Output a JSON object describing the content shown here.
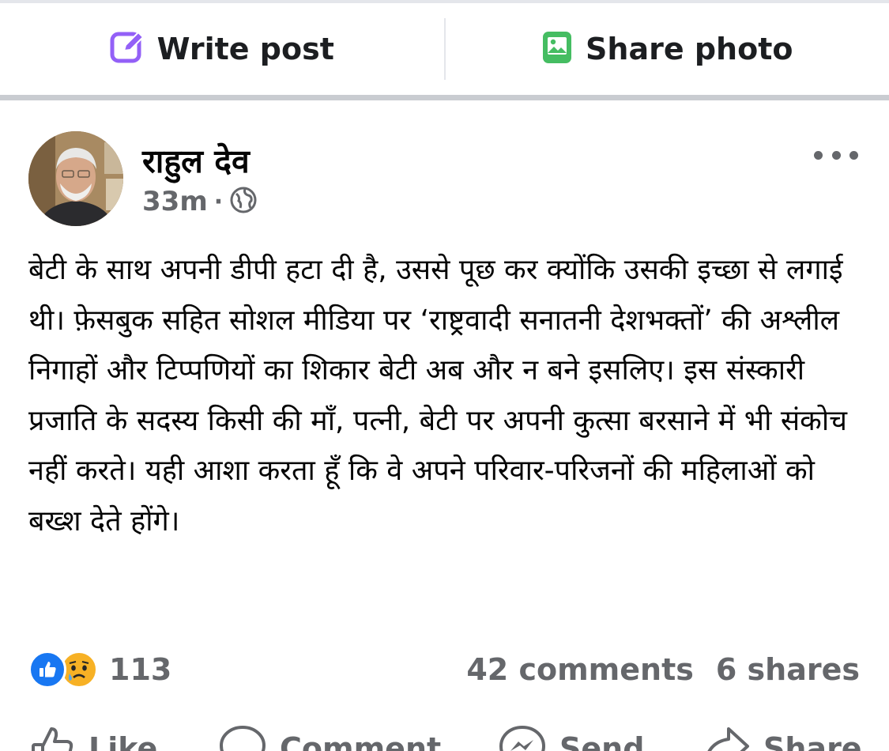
{
  "composer": {
    "write_label": "Write post",
    "share_photo_label": "Share photo",
    "write_icon": "edit-icon",
    "photo_icon": "photo-icon",
    "write_icon_color": "#9360f7",
    "photo_icon_color": "#45bd62"
  },
  "post": {
    "author": "राहुल देव",
    "time": "33m",
    "audience_icon": "globe-icon",
    "text": "बेटी के साथ अपनी डीपी हटा दी है, उससे पूछ कर क्योंकि उसकी इच्छा से लगाई थी। फ़ेसबुक सहित सोशल मीडिया पर ‘राष्ट्रवादी सनातनी देशभक्तों’ की अश्लील निगाहों और टिप्पणियों का शिकार बेटी अब और न बने इसलिए। इस संस्कारी प्रजाति के सदस्य किसी की माँ, पत्नी, बेटी पर अपनी कुत्सा बरसाने में भी संकोच नहीं करते। यही आशा करता हूँ कि वे अपने परिवार-परिजनों की महिलाओं को बख्श देते होंगे।"
  },
  "stats": {
    "reaction_count": "113",
    "reactions": [
      "like",
      "sad"
    ],
    "comments": "42 comments",
    "shares": "6 shares"
  },
  "actions": {
    "like": "Like",
    "comment": "Comment",
    "send": "Send",
    "share": "Share"
  },
  "colors": {
    "like_blue": "#1877f2",
    "sad_yellow": "#f7b125",
    "secondary_text": "#65676b"
  }
}
